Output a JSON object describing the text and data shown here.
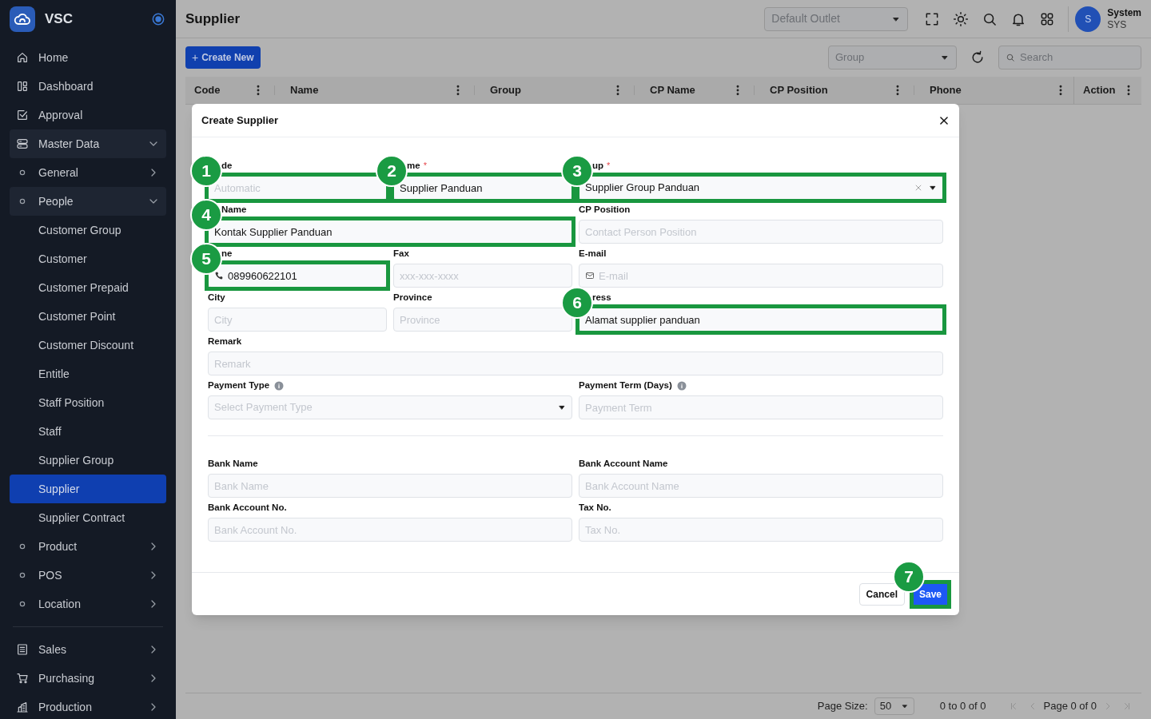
{
  "app": {
    "name": "VSC"
  },
  "nav": [
    {
      "label": "Home",
      "selected": false
    },
    {
      "label": "Dashboard",
      "selected": false
    },
    {
      "label": "Approval",
      "selected": false
    },
    {
      "label": "Master Data",
      "selected": false,
      "expanded": true,
      "children": [
        {
          "label": "General",
          "selected": false,
          "expanded": false
        },
        {
          "label": "People",
          "selected": false,
          "expanded": true,
          "children": [
            {
              "label": "Customer Group",
              "selected": false
            },
            {
              "label": "Customer",
              "selected": false
            },
            {
              "label": "Customer Prepaid",
              "selected": false
            },
            {
              "label": "Customer Point",
              "selected": false
            },
            {
              "label": "Customer Discount",
              "selected": false
            },
            {
              "label": "Entitle",
              "selected": false
            },
            {
              "label": "Staff Position",
              "selected": false
            },
            {
              "label": "Staff",
              "selected": false
            },
            {
              "label": "Supplier Group",
              "selected": false
            },
            {
              "label": "Supplier",
              "selected": true
            },
            {
              "label": "Supplier Contract",
              "selected": false
            }
          ]
        },
        {
          "label": "Product",
          "selected": false,
          "expanded": false
        },
        {
          "label": "POS",
          "selected": false,
          "expanded": false
        },
        {
          "label": "Location",
          "selected": false,
          "expanded": false
        }
      ]
    },
    {
      "label": "Sales",
      "selected": false,
      "expanded": false
    },
    {
      "label": "Purchasing",
      "selected": false,
      "expanded": false
    },
    {
      "label": "Production",
      "selected": false,
      "expanded": false
    }
  ],
  "header": {
    "title": "Supplier",
    "outlet": {
      "placeholder": "Default Outlet"
    },
    "user": {
      "initial": "S",
      "name": "System",
      "code": "SYS"
    }
  },
  "toolbar": {
    "create_button": "Create New",
    "create_icon": "+",
    "group_filter": {
      "placeholder": "Group"
    },
    "search": {
      "placeholder": "Search"
    }
  },
  "table": {
    "columns": [
      "Code",
      "Name",
      "Group",
      "CP Name",
      "CP Position",
      "Phone",
      "Action"
    ]
  },
  "pagination": {
    "page_size_label": "Page Size:",
    "page_size": "50",
    "range": "0 to 0 of 0",
    "page": "Page 0 of 0"
  },
  "dialog": {
    "title": "Create Supplier",
    "sections": [
      [
        {
          "label": "de",
          "kind": "text",
          "placeholder": "Automatic",
          "annotation": "1"
        },
        {
          "label": "me",
          "required_mark": "*",
          "kind": "text",
          "value": "Supplier Panduan",
          "annotation": "2"
        },
        {
          "label": "up",
          "required_mark": "*",
          "kind": "select",
          "value": "Supplier Group Panduan",
          "clearable": true,
          "annotation": "3"
        },
        {
          "label": "Name",
          "kind": "text",
          "value": "Kontak Supplier Panduan",
          "annotation": "4"
        },
        {
          "label": "CP Position",
          "kind": "text",
          "placeholder": "Contact Person Position"
        },
        {
          "label": "ne",
          "kind": "phone",
          "value": "089960622101",
          "annotation": "5"
        },
        {
          "label": "Fax",
          "kind": "text",
          "placeholder": "xxx-xxx-xxxx"
        },
        {
          "label": "E-mail",
          "kind": "email",
          "placeholder": "E-mail"
        },
        {
          "label": "City",
          "kind": "text",
          "placeholder": "City"
        },
        {
          "label": "Province",
          "kind": "text",
          "placeholder": "Province"
        },
        {
          "label": "ress",
          "kind": "text",
          "value": "Alamat supplier panduan",
          "annotation": "6"
        },
        {
          "label": "Remark",
          "kind": "text",
          "placeholder": "Remark"
        },
        {
          "label": "Payment Type",
          "kind": "select",
          "placeholder": "Select Payment Type",
          "info": true
        },
        {
          "label": "Payment Term (Days)",
          "kind": "text",
          "placeholder": "Payment Term",
          "info": true
        }
      ],
      [
        {
          "label": "Bank Name",
          "kind": "text",
          "placeholder": "Bank Name"
        },
        {
          "label": "Bank Account Name",
          "kind": "text",
          "placeholder": "Bank Account Name"
        },
        {
          "label": "Bank Account No.",
          "kind": "text",
          "placeholder": "Bank Account No."
        },
        {
          "label": "Tax No.",
          "kind": "text",
          "placeholder": "Tax No."
        }
      ]
    ],
    "buttons": [
      {
        "label": "Cancel",
        "kind": "secondary"
      },
      {
        "label": "Save",
        "kind": "primary",
        "annotation": "7"
      }
    ]
  }
}
